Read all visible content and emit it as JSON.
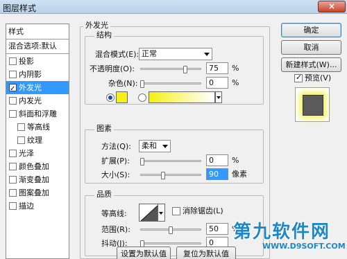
{
  "window": {
    "title": "图层样式",
    "close_glyph": "×"
  },
  "stylelist": {
    "header": "样式",
    "blend_default": "混合选项:默认",
    "items": [
      {
        "label": "投影",
        "checked": false,
        "selected": false,
        "child": false
      },
      {
        "label": "内阴影",
        "checked": false,
        "selected": false,
        "child": false
      },
      {
        "label": "外发光",
        "checked": true,
        "selected": true,
        "child": false
      },
      {
        "label": "内发光",
        "checked": false,
        "selected": false,
        "child": false
      },
      {
        "label": "斜面和浮雕",
        "checked": false,
        "selected": false,
        "child": false
      },
      {
        "label": "等高线",
        "checked": false,
        "selected": false,
        "child": true
      },
      {
        "label": "纹理",
        "checked": false,
        "selected": false,
        "child": true
      },
      {
        "label": "光泽",
        "checked": false,
        "selected": false,
        "child": false
      },
      {
        "label": "颜色叠加",
        "checked": false,
        "selected": false,
        "child": false
      },
      {
        "label": "渐变叠加",
        "checked": false,
        "selected": false,
        "child": false
      },
      {
        "label": "图案叠加",
        "checked": false,
        "selected": false,
        "child": false
      },
      {
        "label": "描边",
        "checked": false,
        "selected": false,
        "child": false
      }
    ]
  },
  "outer_glow": {
    "title": "外发光",
    "structure": {
      "title": "结构",
      "blend_mode_label": "混合模式(E):",
      "blend_mode_value": "正常",
      "opacity_label": "不透明度(O):",
      "opacity_value": "75",
      "opacity_fraction": 0.75,
      "noise_label": "杂色(N):",
      "noise_value": "0",
      "noise_fraction": 0.0,
      "unit": "%",
      "color_mode": "solid",
      "glow_color": "#f7f012"
    },
    "elements": {
      "title": "图素",
      "technique_label": "方法(Q):",
      "technique_value": "柔和",
      "spread_label": "扩展(P):",
      "spread_value": "0",
      "spread_fraction": 0.0,
      "size_label": "大小(S):",
      "size_value": "90",
      "size_fraction": 0.36,
      "unit": "%",
      "size_unit": "像素"
    },
    "quality": {
      "title": "品质",
      "contour_label": "等高线:",
      "antialias_label": "消除锯齿(L)",
      "antialias_checked": false,
      "range_label": "范围(R):",
      "range_value": "50",
      "range_fraction": 0.5,
      "jitter_label": "抖动(J):",
      "jitter_value": "0",
      "jitter_fraction": 0.0,
      "unit": "%"
    },
    "make_default": "设置为默认值",
    "reset_default": "复位为默认值"
  },
  "actions": {
    "ok": "确定",
    "cancel": "取消",
    "new_style": "新建样式(W)...",
    "preview_label": "预览(V)",
    "preview_checked": true
  },
  "watermark": {
    "big": "第九软件网",
    "small": "WWW.D9SOFT.COM"
  }
}
